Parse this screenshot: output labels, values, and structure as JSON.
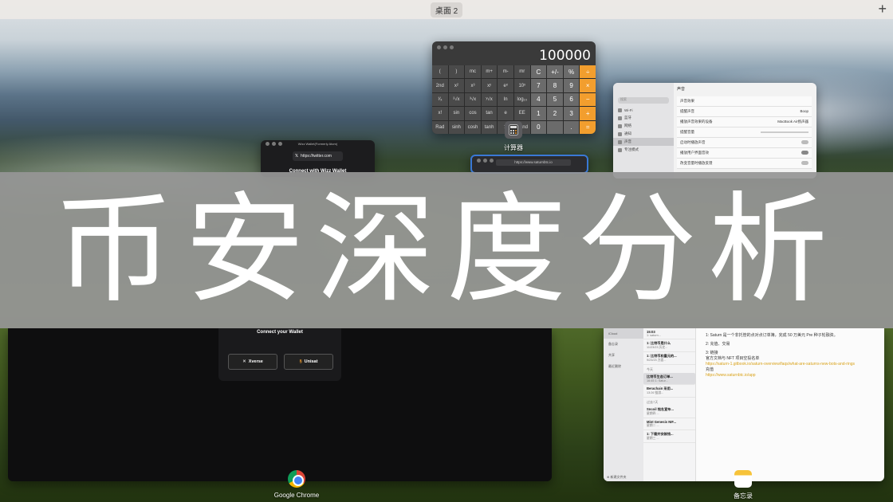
{
  "topbar": {
    "space": "桌面 2",
    "add_label": "+"
  },
  "calculator": {
    "display": "100000",
    "app_label": "计算器",
    "keys": [
      "(",
      ")",
      "mc",
      "m+",
      "m-",
      "mr",
      "C",
      "+/-",
      "%",
      "÷",
      "2nd",
      "x²",
      "x³",
      "xʸ",
      "eˣ",
      "10ˣ",
      "7",
      "8",
      "9",
      "×",
      "¹⁄ₓ",
      "²√x",
      "³√x",
      "ʸ√x",
      "ln",
      "log₁₀",
      "4",
      "5",
      "6",
      "−",
      "x!",
      "sin",
      "cos",
      "tan",
      "e",
      "EE",
      "1",
      "2",
      "3",
      "+",
      "Rad",
      "sinh",
      "cosh",
      "tanh",
      "π",
      "Rand",
      "0",
      "",
      ".",
      "="
    ]
  },
  "settings": {
    "search": "搜索",
    "sidebar": [
      "Wi-Fi",
      "蓝牙",
      "网络",
      "通知",
      "声音",
      "专注模式"
    ],
    "section_title": "声音",
    "rows": [
      {
        "label": "声音效果",
        "value": ""
      },
      {
        "label": "提醒声音",
        "value": "Boop"
      },
      {
        "label": "播放声音效果的设备",
        "value": "MacBook Air扬声器"
      },
      {
        "label": "提醒音量",
        "value": ""
      },
      {
        "label": "启动时播放声音",
        "value": ""
      },
      {
        "label": "播放用户界面音效",
        "value": ""
      },
      {
        "label": "改变音量时播放反馈",
        "value": ""
      }
    ]
  },
  "wizz": {
    "title": "Wizz Wallet(Formerly Atom)",
    "url": "https://twitter.com",
    "heading": "Connect with Wizz Wallet"
  },
  "browser": {
    "url": "https://www.saturnbtc.io"
  },
  "chrome": {
    "app_label": "Google Chrome",
    "connect_title": "Connect your Wallet",
    "buttons": [
      "Xverse",
      "Unisat"
    ]
  },
  "banner": {
    "text": "币安深度分析"
  },
  "notes": {
    "app_label": "备忘录",
    "sidebar": [
      "iCloud",
      "备忘录",
      "共享",
      "最近删除"
    ],
    "new_folder": "新建文件夹",
    "groups": [
      {
        "label": "",
        "items": [
          {
            "title": "15:03",
            "sub": "1: saturn..."
          },
          {
            "title": "1: 比特币是什么",
            "sub": "11/23/23 历史..."
          },
          {
            "title": "1: 比特币和重元的...",
            "sub": "9/23/23 方面..."
          }
        ]
      },
      {
        "label": "今天",
        "items": [
          {
            "title": "比特币生态订单...",
            "sub": "16:45 1: Satur..."
          },
          {
            "title": "Berachain 采用...",
            "sub": "13:26 链游..."
          }
        ]
      },
      {
        "label": "过去7天",
        "items": [
          {
            "title": "Sncoil 铭名宣布...",
            "sub": "星期四 ..."
          },
          {
            "title": "Mint Genesis NIF...",
            "sub": "星期二 ..."
          },
          {
            "title": "1: 下载并安装钱...",
            "sub": "星期三 ..."
          }
        ]
      }
    ],
    "body": [
      "1: Saturn 是一个非托管的点对点订单簿，完成 50 万美元 Pre 种子轮融资。",
      "2: 充值、交易",
      "3: 链接",
      "官方文档与 NFT 项目空投名单",
      "https://saturn-1.gitbook.io/saturn-overview/faqs/what-are-saturns-new-bots-and-rings",
      "充值",
      "https://www.saturnbtc.io/app"
    ]
  }
}
